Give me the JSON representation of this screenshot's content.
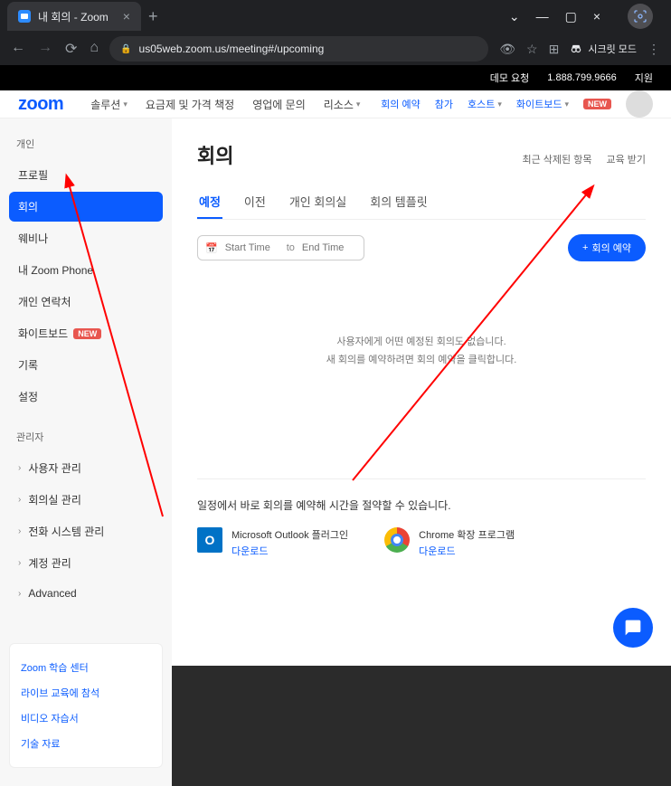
{
  "browser": {
    "tab_title": "내 회의 - Zoom",
    "url": "us05web.zoom.us/meeting#/upcoming",
    "incognito_label": "시크릿 모드"
  },
  "top_bar": {
    "demo": "데모 요청",
    "phone": "1.888.799.9666",
    "support": "지원"
  },
  "header": {
    "logo": "zoom",
    "nav": {
      "solutions": "솔루션",
      "pricing": "요금제 및 가격 책정",
      "sales": "영업에 문의",
      "resources": "리소스"
    },
    "right": {
      "schedule": "회의 예약",
      "join": "참가",
      "host": "호스트",
      "whiteboard": "화이트보드",
      "new_badge": "NEW"
    }
  },
  "sidebar": {
    "section_personal": "개인",
    "items": {
      "profile": "프로필",
      "meeting": "회의",
      "webinar": "웨비나",
      "phone": "내 Zoom Phone",
      "contacts": "개인 연락처",
      "whiteboard": "화이트보드",
      "recording": "기록",
      "settings": "설정"
    },
    "section_admin": "관리자",
    "admin_items": {
      "users": "사용자 관리",
      "rooms": "회의실 관리",
      "phone_sys": "전화 시스템 관리",
      "account": "계정 관리",
      "advanced": "Advanced"
    },
    "links": {
      "learning": "Zoom 학습 센터",
      "live": "라이브 교육에 참석",
      "video": "비디오 자습서",
      "knowledge": "기술 자료"
    }
  },
  "page": {
    "title": "회의",
    "head_links": {
      "deleted": "최근 삭제된 항목",
      "training": "교육 받기"
    },
    "tabs": {
      "upcoming": "예정",
      "previous": "이전",
      "rooms": "개인 회의실",
      "templates": "회의 템플릿"
    },
    "date": {
      "start_ph": "Start Time",
      "to": "to",
      "end_ph": "End Time"
    },
    "schedule_btn": "회의 예약",
    "empty": {
      "line1": "사용자에게 어떤 예정된 회의도 없습니다.",
      "line2": "새 회의를 예약하려면 회의 예약을 클릭합니다."
    },
    "sched_text": "일정에서 바로 회의를 예약해 시간을 절약할 수 있습니다.",
    "outlook": {
      "title": "Microsoft Outlook 플러그인",
      "link": "다운로드"
    },
    "chrome": {
      "title": "Chrome 확장 프로그램",
      "link": "다운로드"
    }
  }
}
